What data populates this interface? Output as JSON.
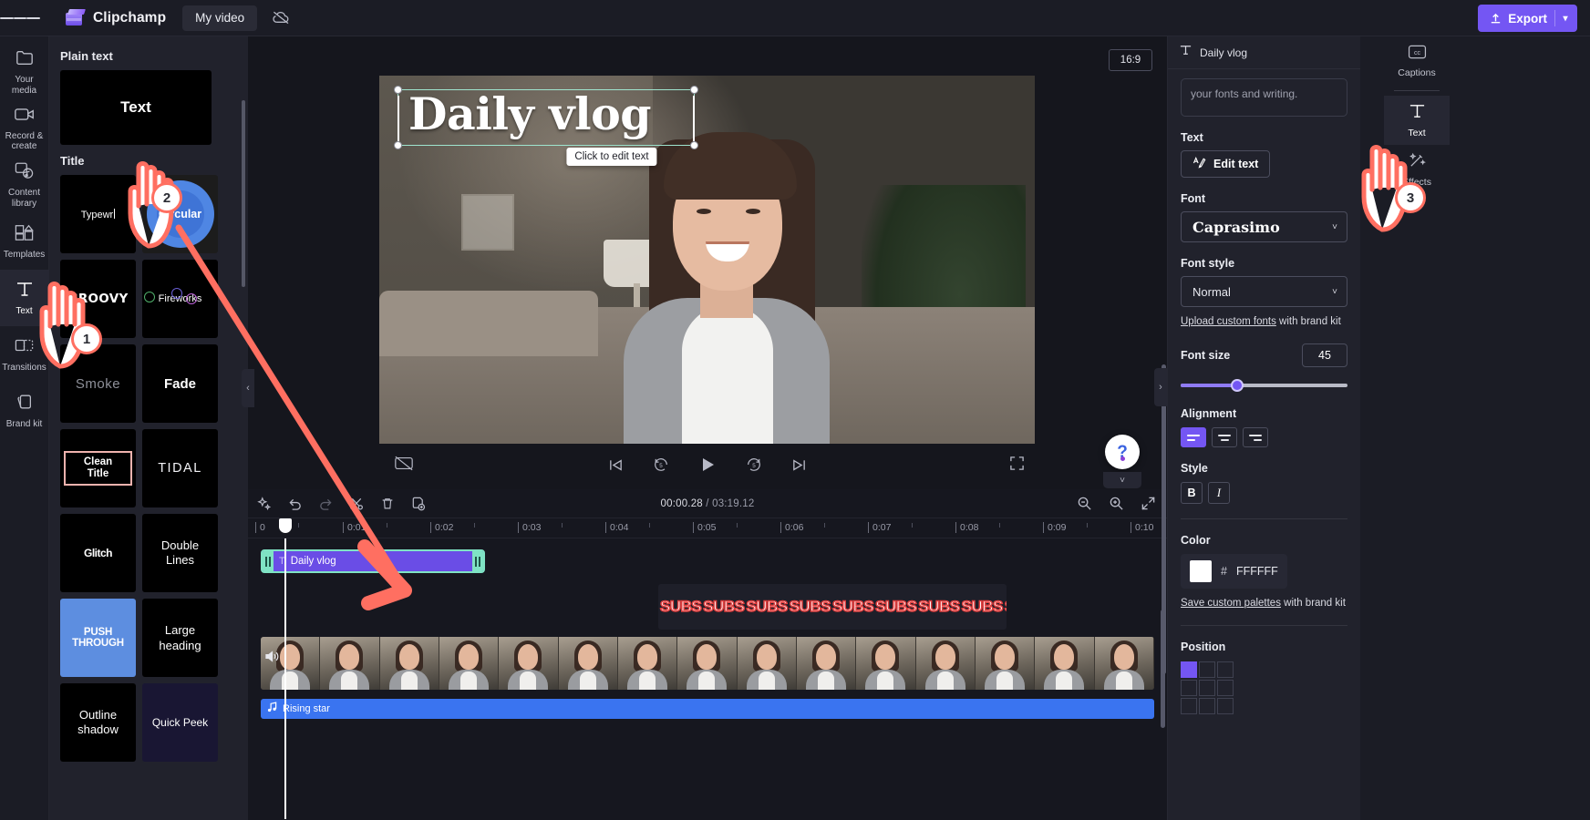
{
  "topbar": {
    "menu_icon": "hamburger-icon",
    "brand": "Clipchamp",
    "project_tab": "My video",
    "cloud_icon": "cloud-off-icon",
    "export_label": "Export",
    "export_icon": "upload-icon",
    "export_caret": "▾"
  },
  "rail": {
    "items": [
      {
        "label": "Your media",
        "icon": "folder-icon",
        "active": false
      },
      {
        "label": "Record & create",
        "icon": "video-camera-icon",
        "active": false
      },
      {
        "label": "Content library",
        "icon": "library-icon",
        "active": false
      },
      {
        "label": "Templates",
        "icon": "templates-icon",
        "active": false
      },
      {
        "label": "Text",
        "icon": "text-icon",
        "active": true
      },
      {
        "label": "Transitions",
        "icon": "transitions-icon",
        "active": false
      },
      {
        "label": "Brand kit",
        "icon": "brand-kit-icon",
        "active": false
      }
    ]
  },
  "library": {
    "plain_heading": "Plain text",
    "plain_tile": "Text",
    "title_heading": "Title",
    "tiles": [
      {
        "label": "Typewr",
        "style": "typewriter"
      },
      {
        "label": "Circular",
        "style": "circular"
      },
      {
        "label": "GROOVY",
        "style": "groovy"
      },
      {
        "label": "Fireworks",
        "style": "fireworks"
      },
      {
        "label": "Smoke",
        "style": "smoke"
      },
      {
        "label": "Fade",
        "style": "fade"
      },
      {
        "label": "Clean Title",
        "style": "clean"
      },
      {
        "label": "TIDAL",
        "style": "tidal"
      },
      {
        "label": "Glitch",
        "style": "glitch"
      },
      {
        "label": "Double Lines",
        "style": "double"
      },
      {
        "label": "PUSH THROUGH",
        "style": "push"
      },
      {
        "label": "Large heading",
        "style": "large"
      },
      {
        "label": "Outline shadow",
        "style": "outline"
      },
      {
        "label": "Quick Peek",
        "style": "quick"
      }
    ]
  },
  "preview": {
    "aspect_ratio": "16:9",
    "overlay_text": "Daily vlog",
    "edit_tooltip": "Click to edit text",
    "cc_icon": "captions-off-icon",
    "fullscreen_icon": "fullscreen-icon",
    "controls": [
      {
        "name": "skip-to-start",
        "icon": "skip-start-icon"
      },
      {
        "name": "rewind-5",
        "icon": "rewind-5-icon"
      },
      {
        "name": "play",
        "icon": "play-icon"
      },
      {
        "name": "forward-5",
        "icon": "forward-5-icon"
      },
      {
        "name": "skip-to-end",
        "icon": "skip-end-icon"
      }
    ],
    "help_icon": "question-mark-icon",
    "collapse_icon": "chevron-down-icon"
  },
  "timeline": {
    "tools": [
      {
        "name": "magic-tool",
        "icon": "sparkle-icon"
      },
      {
        "name": "undo",
        "icon": "undo-icon"
      },
      {
        "name": "redo",
        "icon": "redo-icon"
      },
      {
        "name": "split",
        "icon": "scissors-icon"
      },
      {
        "name": "delete",
        "icon": "trash-icon"
      },
      {
        "name": "duplicate",
        "icon": "duplicate-icon"
      }
    ],
    "current_time": "00:00.28",
    "separator": " / ",
    "total_time": "03:19.12",
    "zoom_out_icon": "zoom-out-icon",
    "zoom_in_icon": "zoom-in-icon",
    "fit_icon": "fit-to-screen-icon",
    "ruler_ticks": [
      "0",
      "0:01",
      "0:02",
      "0:03",
      "0:04",
      "0:05",
      "0:06",
      "0:07",
      "0:08",
      "0:09",
      "0:10"
    ],
    "clips": {
      "text_clip": "Daily vlog",
      "text_clip_icon": "text-clip-icon",
      "subtitle_clip_word": "SUBS",
      "audio_clip": "Rising star",
      "audio_clip_icon": "music-note-icon",
      "volume_icon": "volume-icon"
    }
  },
  "props": {
    "header_title": "Daily vlog",
    "header_icon": "text-icon",
    "ai_hint": "your fonts and writing.",
    "text_label": "Text",
    "edit_text_label": "Edit text",
    "edit_text_icon": "edit-text-icon",
    "font_label": "Font",
    "font_value": "Caprasimo",
    "font_style_label": "Font style",
    "font_style_value": "Normal",
    "upload_link": "Upload custom fonts",
    "upload_suffix": " with brand kit",
    "font_size_label": "Font size",
    "font_size_value": "45",
    "alignment_label": "Alignment",
    "style_label": "Style",
    "bold_label": "B",
    "italic_label": "I",
    "color_label": "Color",
    "color_hash": "#",
    "color_hex": "FFFFFF",
    "color_swatch": "#FFFFFF",
    "save_palettes_link": "Save custom palettes",
    "save_palettes_suffix": " with brand kit",
    "position_label": "Position",
    "accent_color": "#7456F3"
  },
  "right_tabs": {
    "items": [
      {
        "label": "Captions",
        "icon": "closed-captions-icon",
        "active": false
      },
      {
        "label": "Text",
        "icon": "text-icon",
        "active": true
      },
      {
        "label": "Effects",
        "icon": "magic-wand-icon",
        "active": false
      }
    ]
  },
  "annotations": {
    "steps": [
      "1",
      "2",
      "3"
    ],
    "accent": "#FF6F61"
  }
}
